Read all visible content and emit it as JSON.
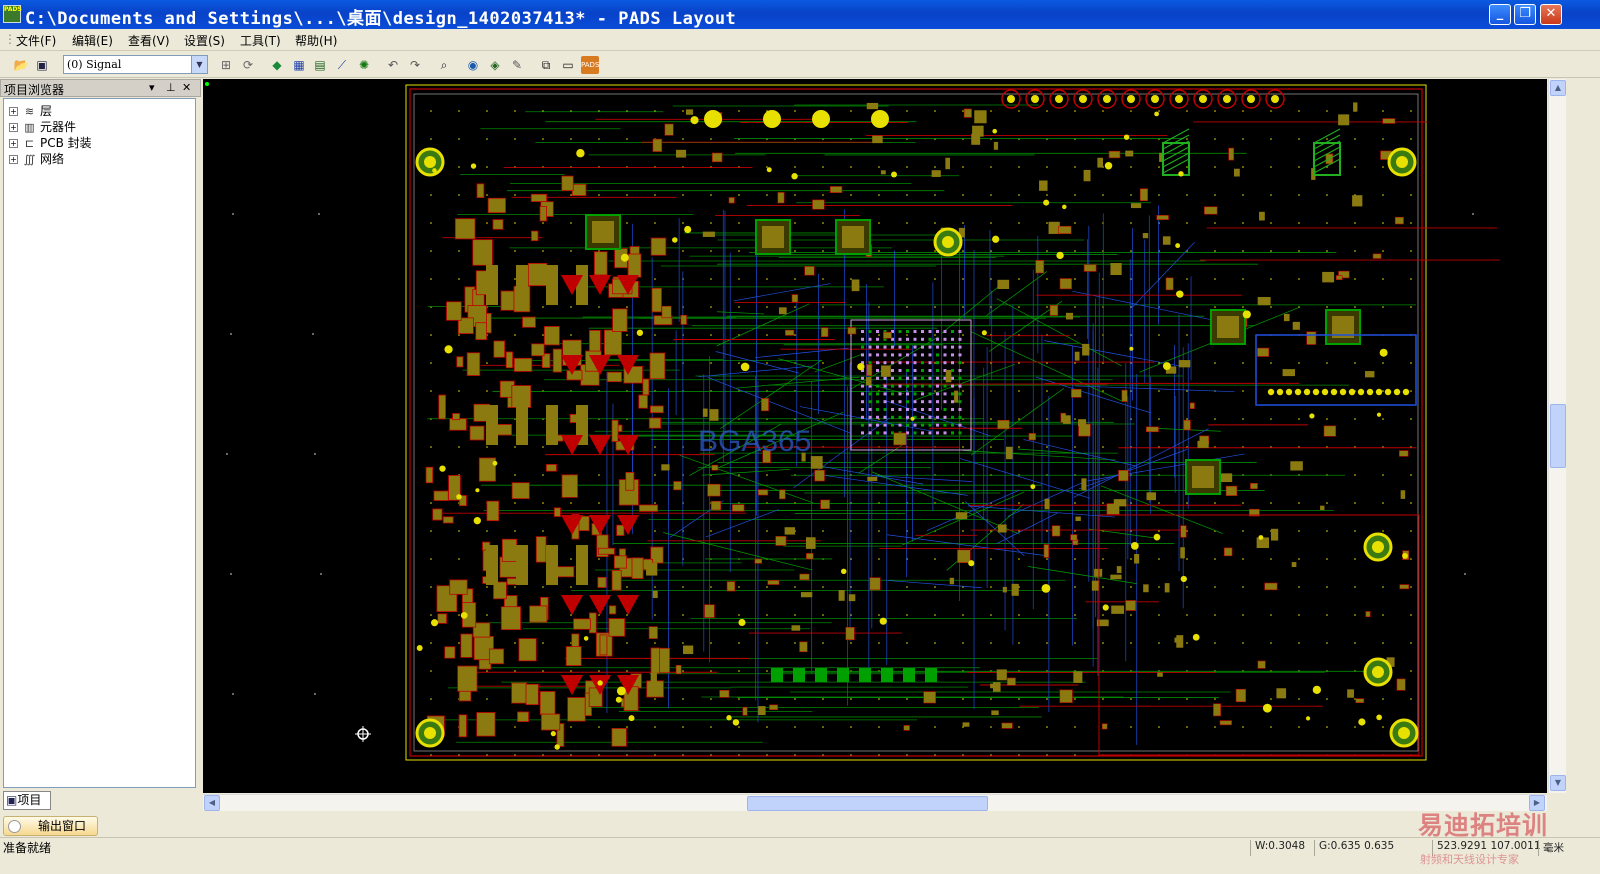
{
  "window": {
    "title": "C:\\Documents and Settings\\...\\桌面\\design_1402037413* - PADS Layout",
    "icon_label": "PADS",
    "controls": [
      "minimize",
      "restore",
      "close"
    ]
  },
  "menu": [
    {
      "label": "文件(F)"
    },
    {
      "label": "编辑(E)"
    },
    {
      "label": "查看(V)"
    },
    {
      "label": "设置(S)"
    },
    {
      "label": "工具(T)"
    },
    {
      "label": "帮助(H)"
    }
  ],
  "toolbar": {
    "layer_value": "(0) Signal",
    "icons": [
      "open-icon",
      "save-icon",
      "properties-icon",
      "redraw-icon",
      "design-toolbar-icon",
      "ecO-icon",
      "drafting-icon",
      "route-icon",
      "net-icon",
      "undo-icon",
      "redo-icon",
      "zoom-icon",
      "view-icon",
      "layers-icon",
      "brush-icon",
      "pad-stack-icon",
      "display-icon",
      "pads-logo-icon"
    ]
  },
  "project_browser": {
    "title": "项目浏览器",
    "items": [
      {
        "label": "层",
        "icon": "layers-icon"
      },
      {
        "label": "元器件",
        "icon": "component-icon"
      },
      {
        "label": "PCB 封装",
        "icon": "decal-icon"
      },
      {
        "label": "网络",
        "icon": "net-icon"
      }
    ],
    "tab_label": "项目"
  },
  "canvas": {
    "background": "#000000",
    "board_label": "BGA365",
    "colors": {
      "pad": "#8a7a10",
      "top_copper": "#c00000",
      "inner_copper": "#00a000",
      "bottom_copper": "#2050e0",
      "via": "#e8e000",
      "outline": "#c0c0c0"
    }
  },
  "output_window": {
    "label": "输出窗口"
  },
  "status": {
    "text": "准备就绪",
    "width": "W:0.3048",
    "grid": "G:0.635 0.635",
    "coords": "523.9291 107.0011",
    "units": "毫米"
  },
  "watermark": {
    "main": "易迪拓培训",
    "sub": "射频和天线设计专家"
  }
}
